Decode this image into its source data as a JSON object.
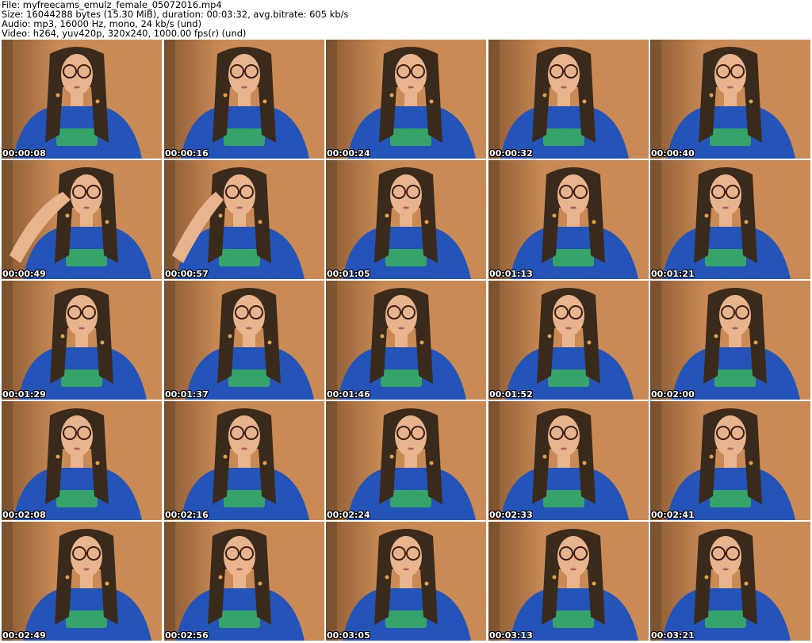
{
  "info": {
    "file": "File: myfreecams_emulz_female_05072016.mp4",
    "size": "Size: 16044288 bytes (15.30 MiB), duration: 00:03:32, avg.bitrate: 605 kb/s",
    "audio": "Audio: mp3, 16000 Hz, mono, 24 kb/s (und)",
    "video": "Video: h264, yuv420p, 320x240, 1000.00 fps(r) (und)"
  },
  "colors": {
    "wall": "#c98a56",
    "wall_dark": "#8a5a32",
    "hair": "#3a2a1c",
    "skin": "#e8b48e",
    "shirt": "#2454b8",
    "print": "#35a36a",
    "glasses": "#3b1f14",
    "bead": "#e0a050"
  },
  "thumbnails": [
    {
      "time": "00:00:08",
      "variant": "a"
    },
    {
      "time": "00:00:16",
      "variant": "b"
    },
    {
      "time": "00:00:24",
      "variant": "a"
    },
    {
      "time": "00:00:32",
      "variant": "b"
    },
    {
      "time": "00:00:40",
      "variant": "a"
    },
    {
      "time": "00:00:49",
      "variant": "hand"
    },
    {
      "time": "00:00:57",
      "variant": "hand"
    },
    {
      "time": "00:01:05",
      "variant": "a"
    },
    {
      "time": "00:01:13",
      "variant": "b"
    },
    {
      "time": "00:01:21",
      "variant": "a"
    },
    {
      "time": "00:01:29",
      "variant": "a"
    },
    {
      "time": "00:01:37",
      "variant": "b"
    },
    {
      "time": "00:01:46",
      "variant": "a"
    },
    {
      "time": "00:01:52",
      "variant": "b"
    },
    {
      "time": "00:02:00",
      "variant": "a"
    },
    {
      "time": "00:02:08",
      "variant": "a"
    },
    {
      "time": "00:02:16",
      "variant": "b"
    },
    {
      "time": "00:02:24",
      "variant": "a"
    },
    {
      "time": "00:02:33",
      "variant": "b"
    },
    {
      "time": "00:02:41",
      "variant": "a"
    },
    {
      "time": "00:02:49",
      "variant": "a"
    },
    {
      "time": "00:02:56",
      "variant": "b"
    },
    {
      "time": "00:03:05",
      "variant": "a"
    },
    {
      "time": "00:03:13",
      "variant": "b"
    },
    {
      "time": "00:03:21",
      "variant": "a"
    }
  ]
}
